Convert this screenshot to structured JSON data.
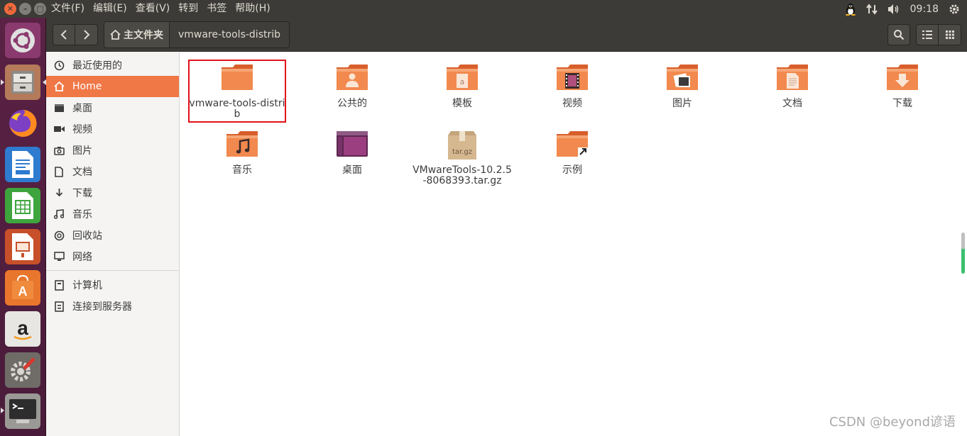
{
  "topbar": {
    "menus": [
      "文件(F)",
      "编辑(E)",
      "查看(V)",
      "转到",
      "书签",
      "帮助(H)"
    ],
    "clock": "09:18",
    "indicator_icons": [
      "linux-tux-icon",
      "network-arrows-icon",
      "volume-icon",
      "clock",
      "settings-gear-icon"
    ]
  },
  "launcher": {
    "items": [
      "ubuntu-dash-icon",
      "files-icon",
      "firefox-icon",
      "writer-icon",
      "calc-icon",
      "impress-icon",
      "software-center-icon",
      "amazon-icon",
      "system-settings-icon",
      "terminal-icon"
    ]
  },
  "header": {
    "home_label": "主文件夹",
    "current_label": "vmware-tools-distrib"
  },
  "sidebar": {
    "items": [
      {
        "label": "最近使用的",
        "icon": "clock-icon"
      },
      {
        "label": "Home",
        "icon": "home-icon",
        "active": true
      },
      {
        "label": "桌面",
        "icon": "desktop-icon"
      },
      {
        "label": "视频",
        "icon": "video-icon"
      },
      {
        "label": "图片",
        "icon": "camera-icon"
      },
      {
        "label": "文档",
        "icon": "document-icon"
      },
      {
        "label": "下载",
        "icon": "download-icon"
      },
      {
        "label": "音乐",
        "icon": "music-icon"
      },
      {
        "label": "回收站",
        "icon": "trash-icon"
      },
      {
        "label": "网络",
        "icon": "network-icon"
      }
    ],
    "items2": [
      {
        "label": "计算机",
        "icon": "computer-icon"
      },
      {
        "label": "连接到服务器",
        "icon": "server-icon"
      }
    ]
  },
  "files": [
    {
      "name": "vmware-tools-distrib",
      "icon": "folder-icon",
      "selected": true
    },
    {
      "name": "公共的",
      "icon": "folder-public-icon"
    },
    {
      "name": "模板",
      "icon": "folder-templates-icon"
    },
    {
      "name": "视频",
      "icon": "folder-videos-icon"
    },
    {
      "name": "图片",
      "icon": "folder-pictures-icon"
    },
    {
      "name": "文档",
      "icon": "folder-documents-icon"
    },
    {
      "name": "下载",
      "icon": "folder-download-icon"
    },
    {
      "name": "音乐",
      "icon": "folder-music-icon"
    },
    {
      "name": "桌面",
      "icon": "folder-desktop-icon"
    },
    {
      "name": "VMwareTools-10.2.5-8068393.tar.gz",
      "icon": "archive-icon",
      "badge": "tar.gz"
    },
    {
      "name": "示例",
      "icon": "folder-link-icon"
    }
  ],
  "watermark": "CSDN @beyond谚语",
  "colors": {
    "accent": "#f07746",
    "selection_outline": "#e2121b",
    "panel": "#3c3b37",
    "launcher": "#5a2245"
  }
}
